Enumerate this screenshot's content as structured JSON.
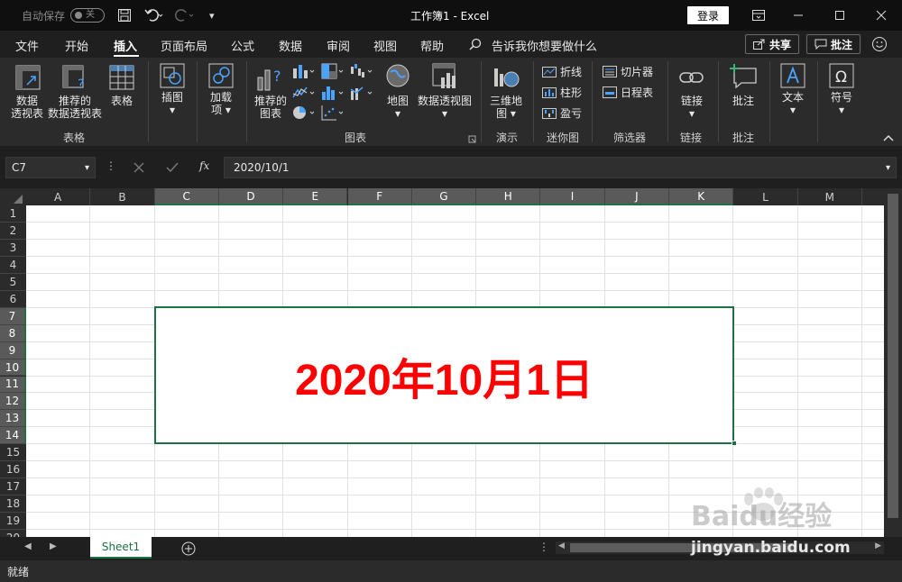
{
  "titlebar": {
    "autosave_label": "自动保存",
    "autosave_state": "关",
    "title": "工作簿1  -  Excel",
    "login": "登录"
  },
  "menu": {
    "tabs": [
      "文件",
      "开始",
      "插入",
      "页面布局",
      "公式",
      "数据",
      "审阅",
      "视图",
      "帮助"
    ],
    "active_tab": "插入",
    "search_placeholder": "告诉我你想要做什么",
    "share": "共享",
    "comment": "批注"
  },
  "ribbon": {
    "pivot_table": [
      "数据",
      "透视表"
    ],
    "recommended_pivot": [
      "推荐的",
      "数据透视表"
    ],
    "table": "表格",
    "group_tables": "表格",
    "illustrations": "插图",
    "addins": [
      "加载",
      "项"
    ],
    "recommended_charts": [
      "推荐的",
      "图表"
    ],
    "maps": "地图",
    "pivot_chart": "数据透视图",
    "group_charts": "图表",
    "map_3d": [
      "三维地",
      "图"
    ],
    "group_tours": "演示",
    "spark_line": "折线",
    "spark_column": "柱形",
    "spark_winloss": "盈亏",
    "group_sparklines": "迷你图",
    "slicer": "切片器",
    "timeline": "日程表",
    "group_filters": "筛选器",
    "link": "链接",
    "group_links": "链接",
    "comment": "批注",
    "group_comments": "批注",
    "text": "文本",
    "symbols": "符号"
  },
  "formula_bar": {
    "name_box": "C7",
    "formula": "2020/10/1",
    "fx": "fx"
  },
  "grid": {
    "columns": [
      "A",
      "B",
      "C",
      "D",
      "E",
      "F",
      "G",
      "H",
      "I",
      "J",
      "K",
      "L",
      "M"
    ],
    "selected_columns": [
      "C",
      "D",
      "E",
      "F",
      "G",
      "H",
      "I",
      "J",
      "K"
    ],
    "rows": [
      "1",
      "2",
      "3",
      "4",
      "5",
      "6",
      "7",
      "8",
      "9",
      "10",
      "11",
      "12",
      "13",
      "14",
      "15",
      "16",
      "17",
      "18",
      "19",
      "20"
    ],
    "selected_rows": [
      "7",
      "8",
      "9",
      "10",
      "11",
      "12",
      "13",
      "14"
    ],
    "merged_cell_text": "2020年10月1日",
    "merged_text_color": "#ff0000",
    "accent_color": "#1e7145"
  },
  "sheets": {
    "tabs": [
      "Sheet1"
    ]
  },
  "status": {
    "text": "就绪"
  },
  "watermark": {
    "logo": "Baidu经验",
    "url": "jingyan.baidu.com"
  }
}
